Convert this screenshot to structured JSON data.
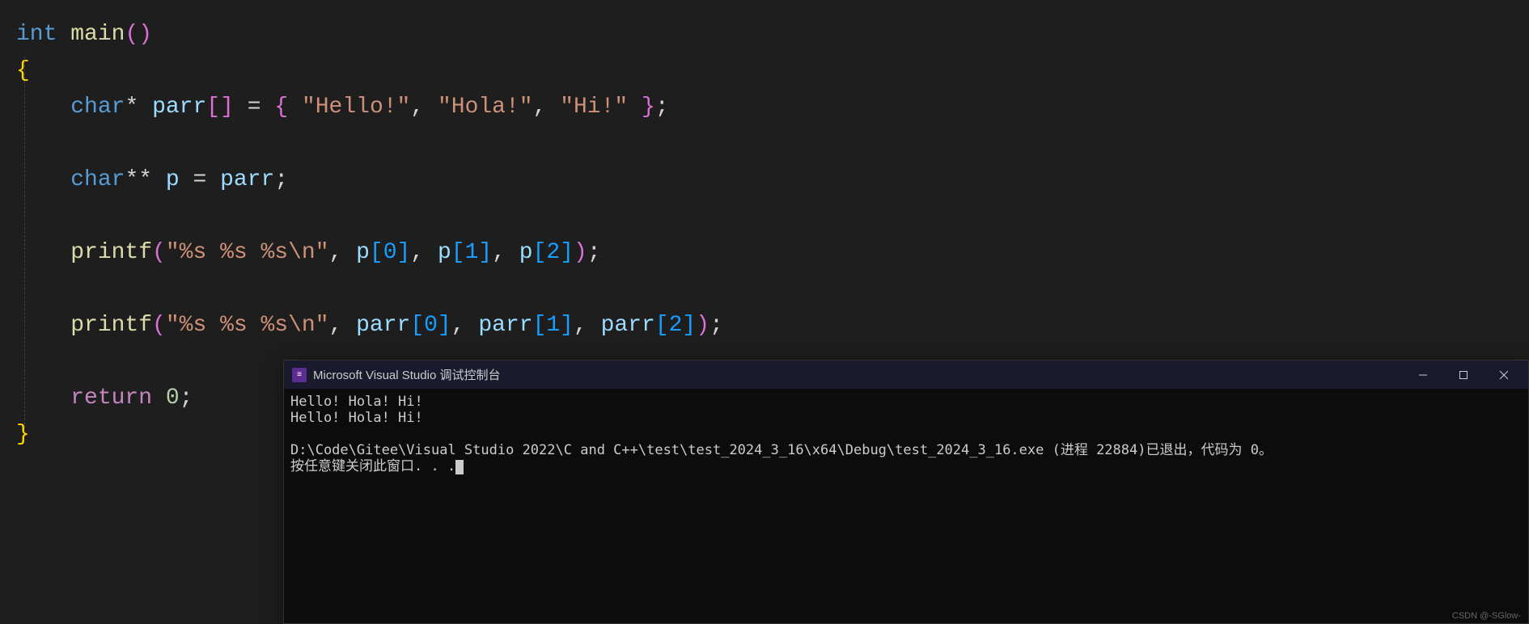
{
  "code": {
    "l1": {
      "kw": "int",
      "fn": "main",
      "p1": "(",
      "p2": ")"
    },
    "l2": {
      "brace": "{"
    },
    "l3": {
      "kw": "char",
      "star": "*",
      "var": "parr",
      "br1": "[",
      "br2": "]",
      "eq": " = ",
      "ob": "{ ",
      "s1": "\"Hello!\"",
      "c1": ", ",
      "s2": "\"Hola!\"",
      "c2": ", ",
      "s3": "\"Hi!\"",
      "cb": " }",
      "semi": ";"
    },
    "l4": {
      "kw": "char",
      "star": "**",
      "var1": "p",
      "eq": " = ",
      "var2": "parr",
      "semi": ";"
    },
    "l5": {
      "fn": "printf",
      "p1": "(",
      "fmt": "\"%s %s %s\\n\"",
      "c1": ", ",
      "v1": "p",
      "b1": "[0]",
      "c2": ", ",
      "v2": "p",
      "b2": "[1]",
      "c3": ", ",
      "v3": "p",
      "b3": "[2]",
      "p2": ")",
      "semi": ";"
    },
    "l6": {
      "fn": "printf",
      "p1": "(",
      "fmt": "\"%s %s %s\\n\"",
      "c1": ", ",
      "v1": "parr",
      "b1": "[0]",
      "c2": ", ",
      "v2": "parr",
      "b2": "[1]",
      "c3": ", ",
      "v3": "parr",
      "b3": "[2]",
      "p2": ")",
      "semi": ";"
    },
    "l7": {
      "kw": "return",
      "sp": " ",
      "num": "0",
      "semi": ";"
    },
    "l8": {
      "brace": "}"
    }
  },
  "console": {
    "title": "Microsoft Visual Studio 调试控制台",
    "icon_text": "≡",
    "out1": "Hello! Hola! Hi!",
    "out2": "Hello! Hola! Hi!",
    "out3": "D:\\Code\\Gitee\\Visual Studio 2022\\C and C++\\test\\test_2024_3_16\\x64\\Debug\\test_2024_3_16.exe (进程 22884)已退出，代码为 0。",
    "out4": "按任意键关闭此窗口. . ."
  },
  "watermark": "CSDN @-SGlow-"
}
